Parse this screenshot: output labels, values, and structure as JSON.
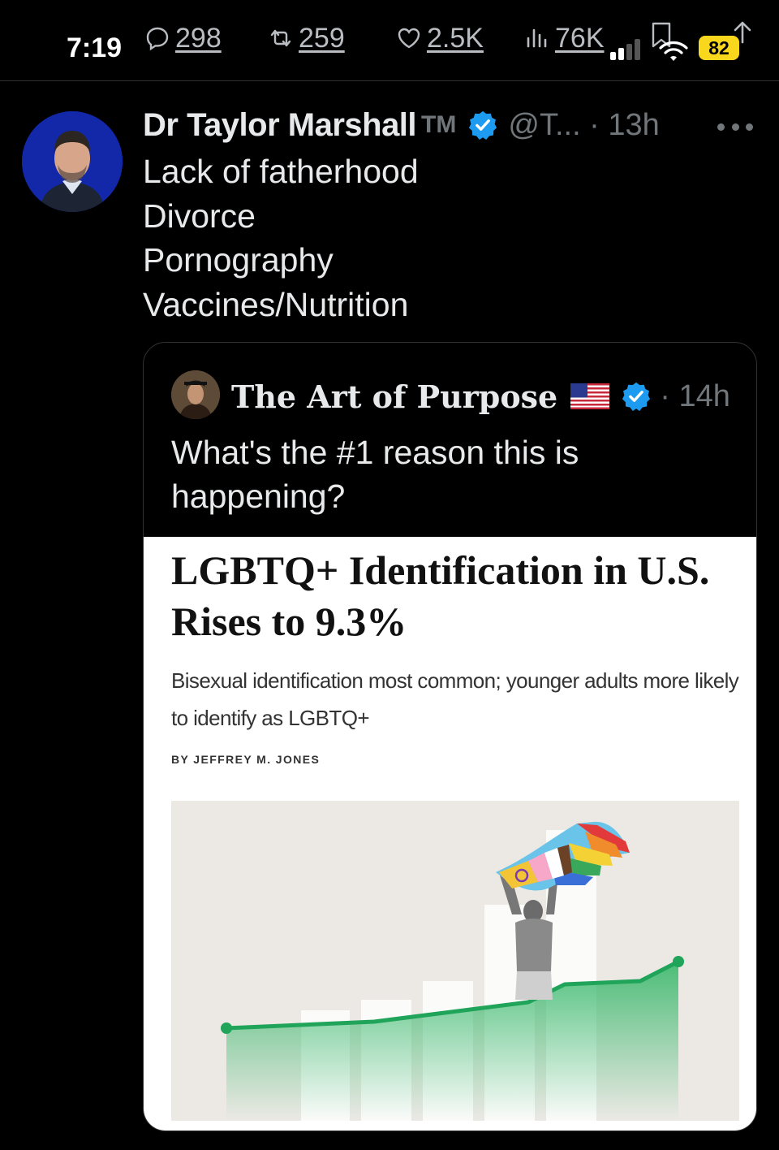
{
  "status_bar": {
    "time": "7:19",
    "battery": "82"
  },
  "engagement": {
    "replies": "298",
    "reposts": "259",
    "likes": "2.5K",
    "views": "76K"
  },
  "tweet": {
    "author_name": "Dr Taylor Marshall",
    "author_badge": "TM",
    "handle_time": "@T... · 13h",
    "lines": [
      "Lack of fatherhood",
      "Divorce",
      "Pornography",
      "Vaccines/Nutrition"
    ]
  },
  "quoted": {
    "author_name": "The Art of Purpose",
    "time": "· 14h",
    "text": "What's the #1 reason this is happening?",
    "article": {
      "title": "LGBTQ+ Identification in U.S. Rises to 9.3%",
      "subtitle": "Bisexual identification most common; younger adults more likely to identify as LGBTQ+",
      "byline": "BY JEFFREY M. JONES"
    }
  },
  "icons": {
    "reply": "reply-icon",
    "repost": "repost-icon",
    "like": "heart-icon",
    "views": "views-icon",
    "bookmark": "bookmark-icon",
    "share": "share-icon",
    "verified": "verified-badge-icon",
    "flag": "us-flag-icon",
    "more": "more-icon"
  },
  "colors": {
    "background": "#000000",
    "text": "#e7e9ea",
    "muted": "#71767b",
    "verified": "#1d9bf0",
    "battery": "#f9d71c",
    "chart_line": "#1fa45a"
  }
}
